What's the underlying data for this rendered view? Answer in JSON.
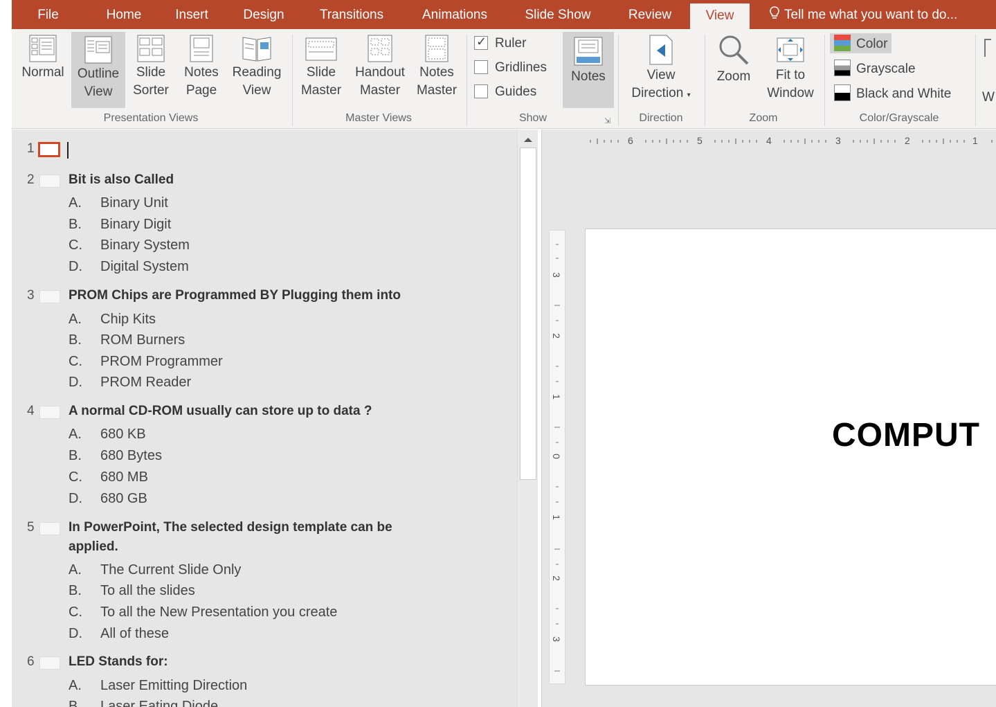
{
  "tabs": [
    {
      "label": "File"
    },
    {
      "label": "Home"
    },
    {
      "label": "Insert"
    },
    {
      "label": "Design"
    },
    {
      "label": "Transitions"
    },
    {
      "label": "Animations"
    },
    {
      "label": "Slide Show"
    },
    {
      "label": "Review"
    },
    {
      "label": "View"
    }
  ],
  "active_tab": "View",
  "tell_me": "Tell me what you want to do...",
  "ribbon": {
    "presentation_views": {
      "label": "Presentation Views",
      "normal": "Normal",
      "outline": [
        "Outline",
        "View"
      ],
      "sorter": [
        "Slide",
        "Sorter"
      ],
      "notes_page": [
        "Notes",
        "Page"
      ],
      "reading": [
        "Reading",
        "View"
      ]
    },
    "master_views": {
      "label": "Master Views",
      "slide": [
        "Slide",
        "Master"
      ],
      "handout": [
        "Handout",
        "Master"
      ],
      "notes": [
        "Notes",
        "Master"
      ]
    },
    "show": {
      "label": "Show",
      "ruler": "Ruler",
      "gridlines": "Gridlines",
      "guides": "Guides",
      "ruler_checked": true,
      "gridlines_checked": false,
      "guides_checked": false,
      "notes": "Notes"
    },
    "direction": {
      "label": "Direction",
      "btn": [
        "View",
        "Direction"
      ]
    },
    "zoom": {
      "label": "Zoom",
      "zoom": "Zoom",
      "fit": [
        "Fit to",
        "Window"
      ]
    },
    "color": {
      "label": "Color/Grayscale",
      "color": "Color",
      "grayscale": "Grayscale",
      "bw": "Black and White"
    },
    "partial": "W"
  },
  "outline": {
    "slides": [
      {
        "num": "1",
        "title": "",
        "options": []
      },
      {
        "num": "2",
        "title": "Bit is also Called",
        "options": [
          [
            "A.",
            "Binary Unit"
          ],
          [
            "B.",
            "Binary Digit"
          ],
          [
            "C.",
            "Binary System"
          ],
          [
            "D.",
            "Digital System"
          ]
        ]
      },
      {
        "num": "3",
        "title": "PROM Chips are Programmed BY Plugging them into",
        "options": [
          [
            "A.",
            "Chip Kits"
          ],
          [
            "B.",
            "ROM Burners"
          ],
          [
            "C.",
            "PROM Programmer"
          ],
          [
            "D.",
            "PROM Reader"
          ]
        ]
      },
      {
        "num": "4",
        "title": "A normal CD-ROM usually can store up to data ?",
        "options": [
          [
            "A.",
            "680 KB"
          ],
          [
            "B.",
            "680 Bytes"
          ],
          [
            "C.",
            "680 MB"
          ],
          [
            "D.",
            "680 GB"
          ]
        ]
      },
      {
        "num": "5",
        "title": "In PowerPoint, The selected design template can be",
        "title2": "applied.",
        "options": [
          [
            "A.",
            "The Current Slide Only"
          ],
          [
            "B.",
            "To all the slides"
          ],
          [
            "C.",
            "To all the New Presentation you create"
          ],
          [
            "D.",
            "All of these"
          ]
        ]
      },
      {
        "num": "6",
        "title": "LED Stands for:",
        "options": [
          [
            "A.",
            "Laser Emitting Direction"
          ],
          [
            "B.",
            "Laser Eating Diode"
          ]
        ]
      }
    ]
  },
  "ruler": {
    "h_marks": [
      "6",
      "5",
      "4",
      "3",
      "2",
      "1"
    ],
    "v_marks": [
      "3",
      "2",
      "1",
      "0",
      "1",
      "2",
      "3"
    ]
  },
  "slide": {
    "title": "COMPUT"
  },
  "colors": {
    "accent": "#b7472a",
    "ribbon_bg": "#f3f2f1",
    "selected": "#d2d2d2"
  }
}
